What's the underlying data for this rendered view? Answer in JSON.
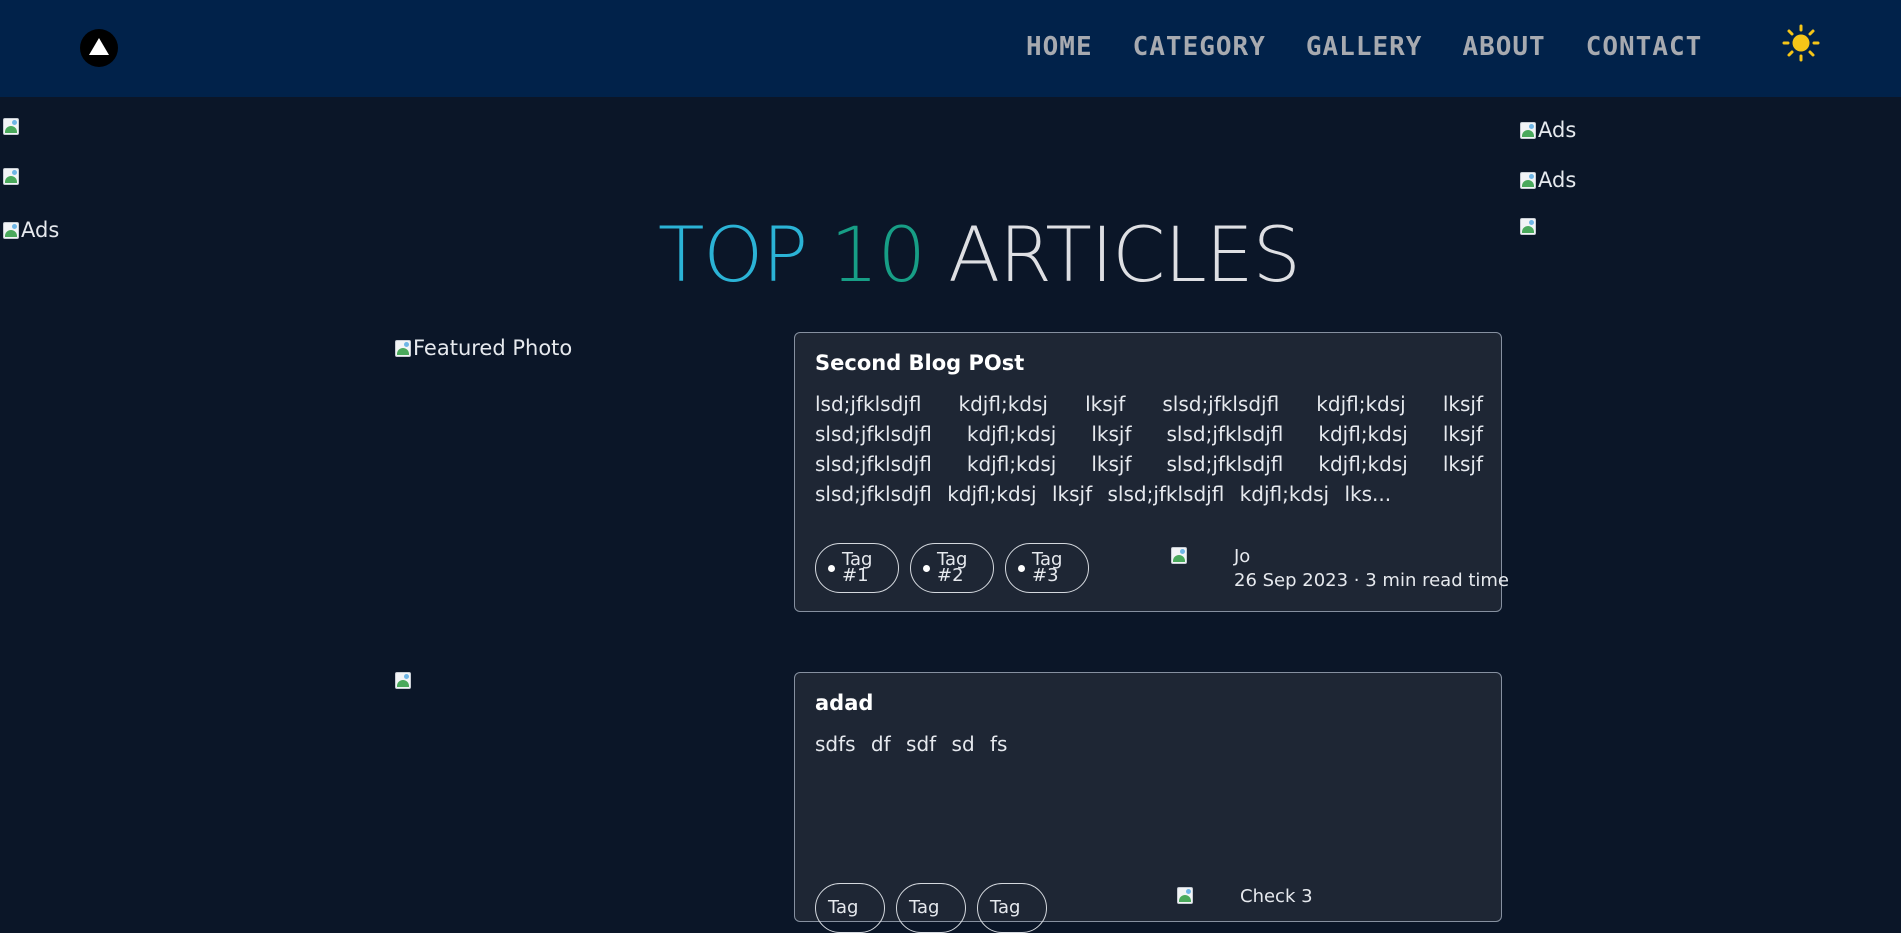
{
  "header": {
    "logo_icon": "triangle-logo-icon",
    "nav": [
      "HOME",
      "CATEGORY",
      "GALLERY",
      "ABOUT",
      "CONTACT"
    ],
    "theme_icon": "sun-icon",
    "theme_color": "#f5c518"
  },
  "ads": {
    "left": [
      "",
      "",
      "Ads"
    ],
    "right": [
      "Ads",
      "Ads",
      ""
    ]
  },
  "heading": {
    "top": "TOP",
    "ten": "10",
    "rest": "ARTICLES"
  },
  "articles": [
    {
      "image_alt": "Featured Photo",
      "title": "Second Blog POst",
      "excerpt": "lsd;jfklsdjfl kdjfl;kdsj lksjf slsd;jfklsdjfl kdjfl;kdsj lksjf slsd;jfklsdjfl kdjfl;kdsj lksjf slsd;jfklsdjfl kdjfl;kdsj lksjf slsd;jfklsdjfl kdjfl;kdsj lksjf slsd;jfklsdjfl kdjfl;kdsj lksjf slsd;jfklsdjfl kdjfl;kdsj lksjf slsd;jfklsdjfl kdjfl;kdsj lks...",
      "tags": [
        "Tag #1",
        "Tag #2",
        "Tag #3"
      ],
      "author": "Jo",
      "meta": "26 Sep 2023 · 3 min read time"
    },
    {
      "image_alt": "",
      "title": "adad",
      "excerpt": "sdfs df sdf sd fs",
      "tags": [
        "Tag",
        "Tag",
        "Tag"
      ],
      "author": "Check 3",
      "meta": ""
    }
  ]
}
